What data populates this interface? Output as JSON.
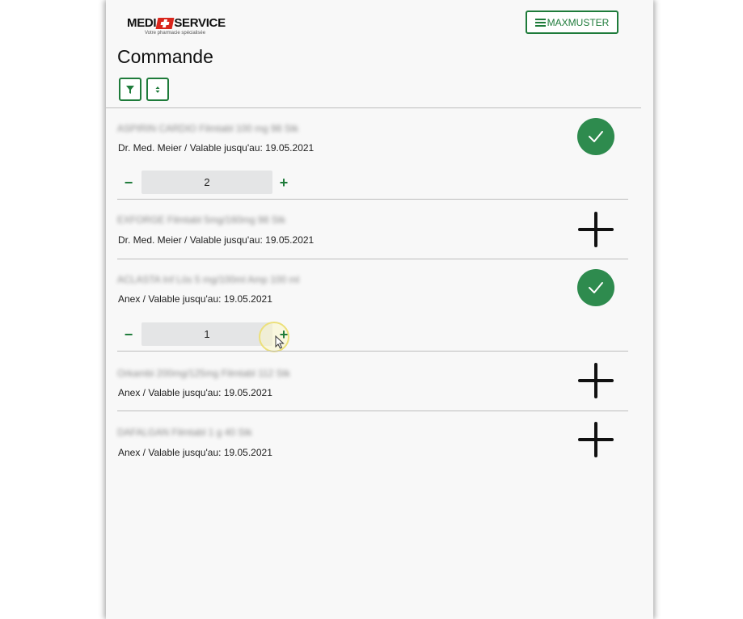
{
  "brand": {
    "name_left": "MEDI",
    "name_right": "SERVICE",
    "tagline": "Votre pharmacie spécialisée"
  },
  "header": {
    "user_label": "MAXMUSTER"
  },
  "page": {
    "title": "Commande"
  },
  "colors": {
    "accent": "#1e7b3a",
    "check": "#2e8b4e",
    "logo_red": "#d9261c"
  },
  "items": [
    {
      "name": "ASPIRIN CARDIO Filmtabl 100 mg 98 Stk",
      "detail": "Dr. Med. Meier / Valable jusqu'au: 19.05.2021",
      "selected": true,
      "quantity": "2",
      "action_icon": "check-icon"
    },
    {
      "name": "EXFORGE Filmtabl 5mg/160mg 98 Stk",
      "detail": "Dr. Med. Meier / Valable jusqu'au: 19.05.2021",
      "selected": false,
      "action_icon": "plus-icon"
    },
    {
      "name": "ACLASTA Inf Lös 5 mg/100ml Amp 100 ml",
      "detail": "Anex / Valable jusqu'au: 19.05.2021",
      "selected": true,
      "quantity": "1",
      "action_icon": "check-icon"
    },
    {
      "name": "Orkambi 200mg/125mg Filmtabl 112 Stk",
      "detail": "Anex / Valable jusqu'au: 19.05.2021",
      "selected": false,
      "action_icon": "plus-icon"
    },
    {
      "name": "DAFALGAN Filmtabl 1 g 40 Stk",
      "detail": "Anex / Valable jusqu'au: 19.05.2021",
      "selected": false,
      "action_icon": "plus-icon"
    }
  ],
  "stepper": {
    "minus": "−",
    "plus": "+"
  }
}
